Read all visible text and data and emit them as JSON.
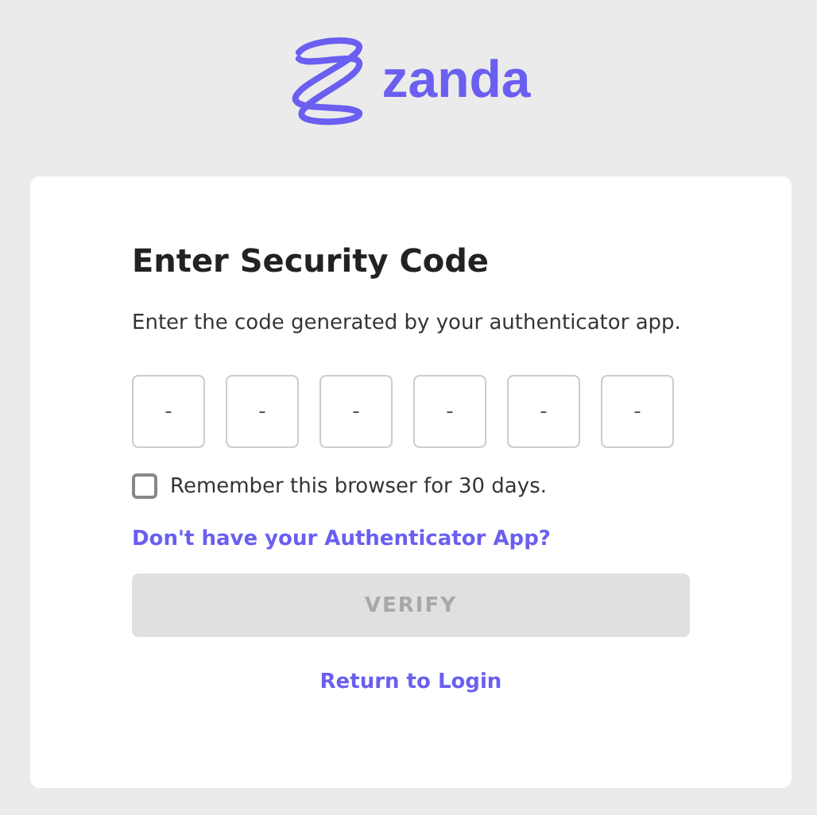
{
  "logo": {
    "text": "zanda"
  },
  "card": {
    "title": "Enter Security Code",
    "subtitle": "Enter the code generated by your authenticator app.",
    "code_fields": [
      {
        "placeholder": "-"
      },
      {
        "placeholder": "-"
      },
      {
        "placeholder": "-"
      },
      {
        "placeholder": "-"
      },
      {
        "placeholder": "-"
      },
      {
        "placeholder": "-"
      }
    ],
    "remember": {
      "label": "Remember this browser for 30 days.",
      "checked": false
    },
    "help_link": "Don't have your Authenticator App?",
    "verify_button": {
      "label": "VERIFY",
      "disabled": true
    },
    "return_link": "Return to Login"
  }
}
